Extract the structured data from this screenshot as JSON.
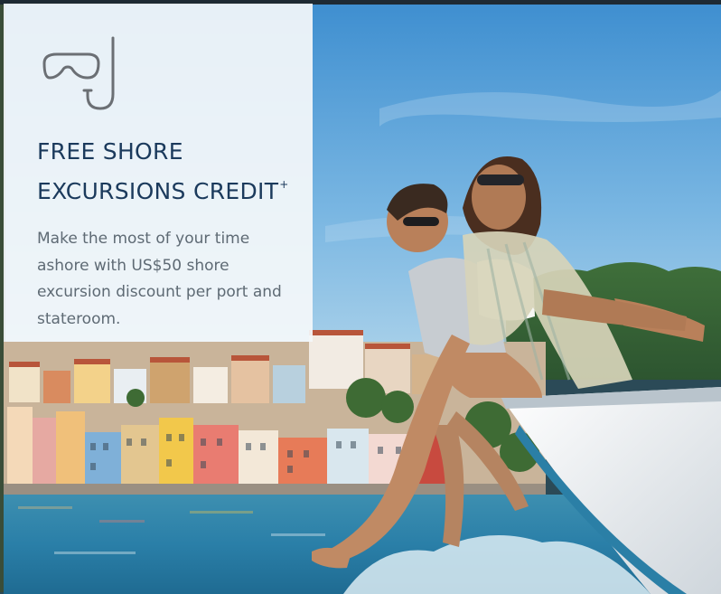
{
  "card": {
    "icon": "snorkel-mask-icon",
    "title": "FREE SHORE EXCURSIONS CREDIT",
    "title_mark": "+",
    "description": "Make the most of your time ashore with US$50 shore excursion discount per port and stateroom."
  },
  "colors": {
    "title": "#1b3a5c",
    "body_text": "#5e6a74",
    "card_bg": "#f4f7fa",
    "sky": "#5aa2d9",
    "sea": "#2a7fa8"
  }
}
